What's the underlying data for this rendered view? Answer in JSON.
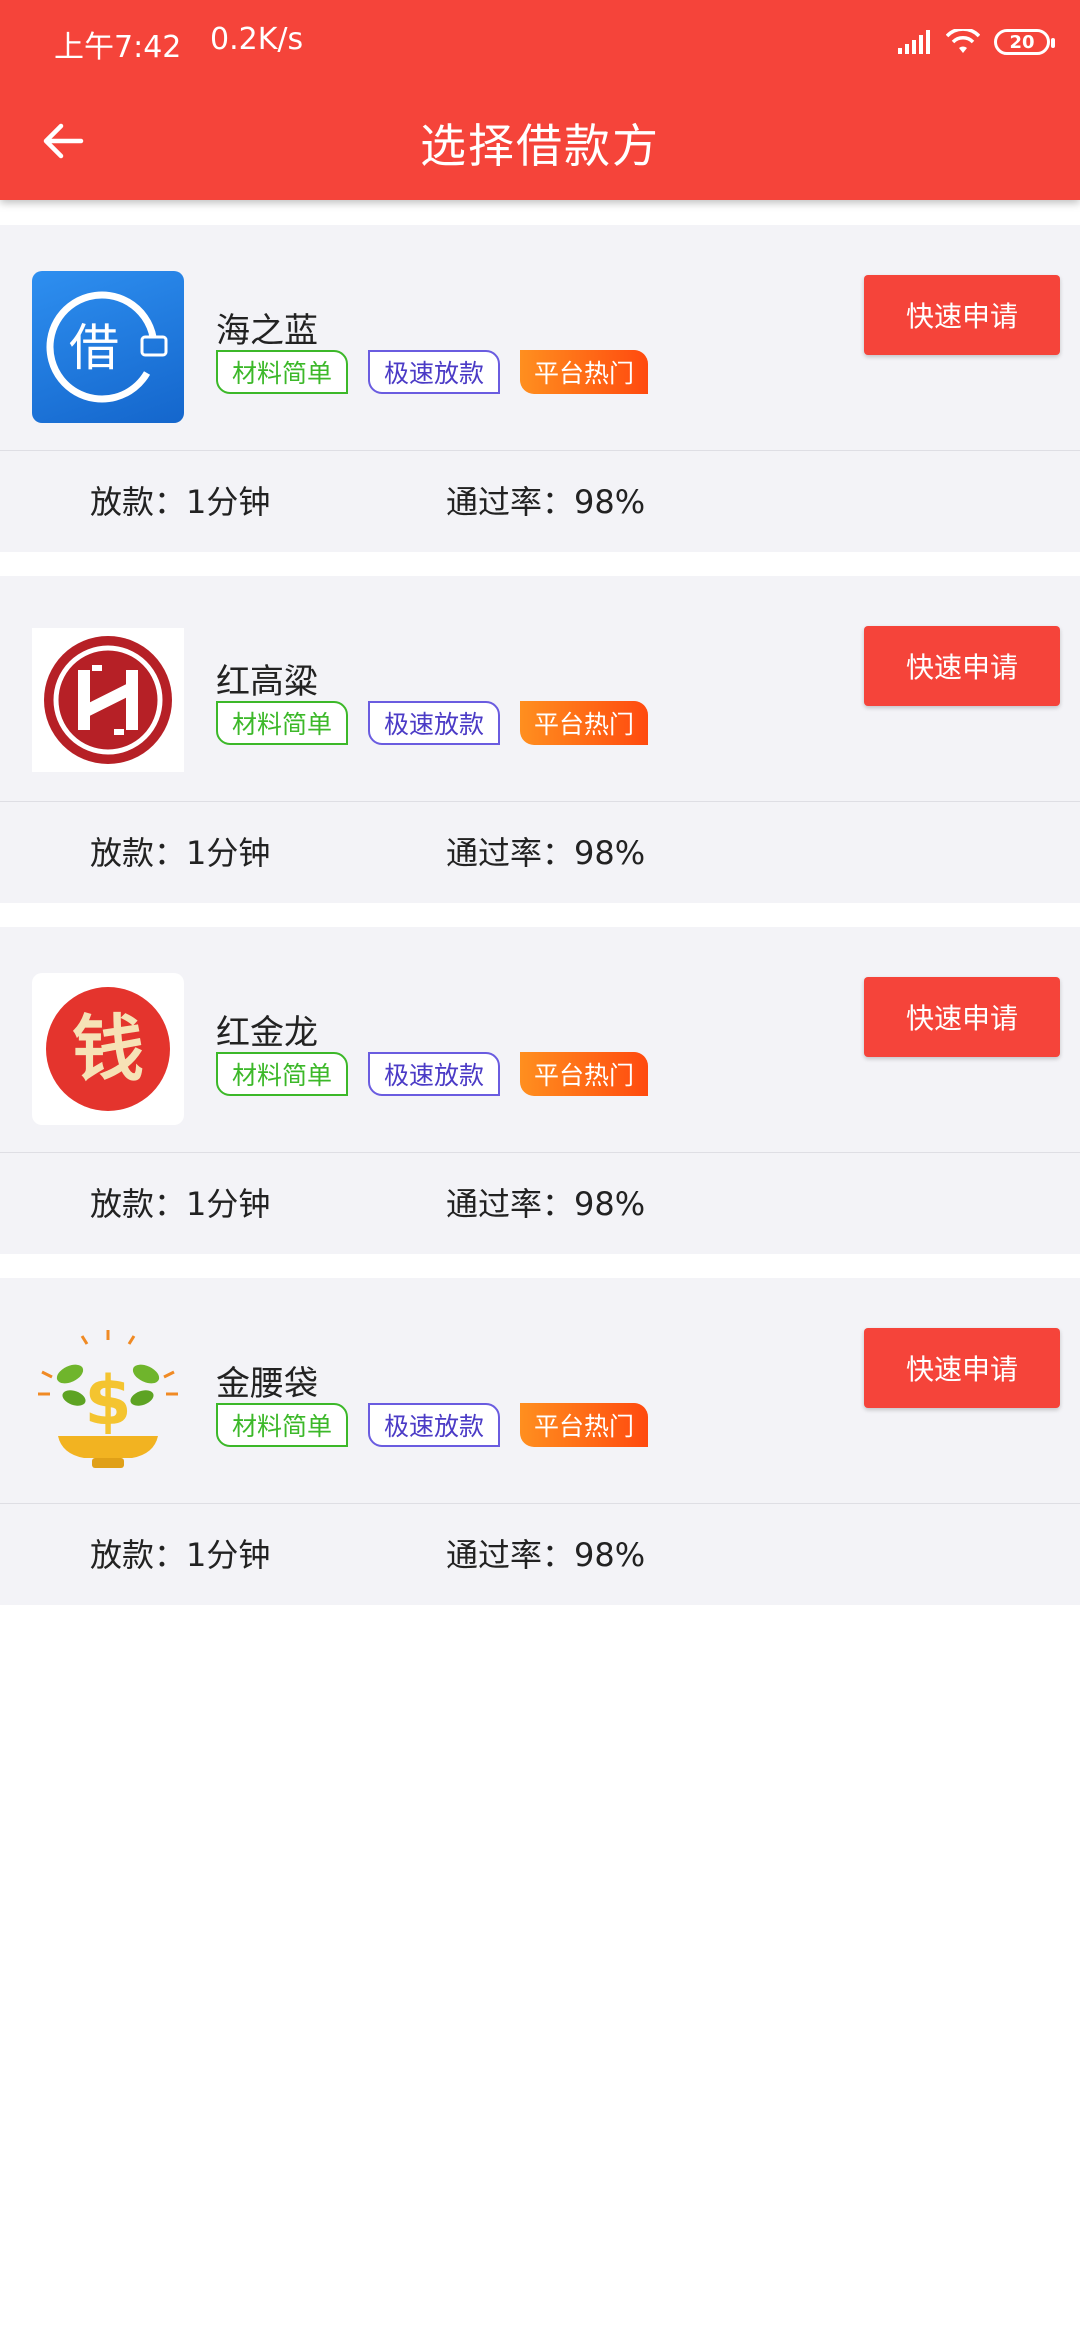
{
  "status_bar": {
    "time": "上午7:42",
    "speed": "0.2K/s",
    "battery": "20"
  },
  "header": {
    "title": "选择借款方",
    "back_icon": "arrow-left-icon",
    "color": "#f5443a"
  },
  "lenders": [
    {
      "name": "海之蓝",
      "logo_text": "借",
      "tags": [
        "材料简单",
        "极速放款",
        "平台热门"
      ],
      "apply_label": "快速申请",
      "loan_time_label": "放款：1分钟",
      "pass_rate_label": "通过率：98%"
    },
    {
      "name": "红高粱",
      "logo_text": "",
      "tags": [
        "材料简单",
        "极速放款",
        "平台热门"
      ],
      "apply_label": "快速申请",
      "loan_time_label": "放款：1分钟",
      "pass_rate_label": "通过率：98%"
    },
    {
      "name": "红金龙",
      "logo_text": "钱",
      "tags": [
        "材料简单",
        "极速放款",
        "平台热门"
      ],
      "apply_label": "快速申请",
      "loan_time_label": "放款：1分钟",
      "pass_rate_label": "通过率：98%"
    },
    {
      "name": "金腰袋",
      "logo_text": "$",
      "tags": [
        "材料简单",
        "极速放款",
        "平台热门"
      ],
      "apply_label": "快速申请",
      "loan_time_label": "放款：1分钟",
      "pass_rate_label": "通过率：98%"
    }
  ]
}
